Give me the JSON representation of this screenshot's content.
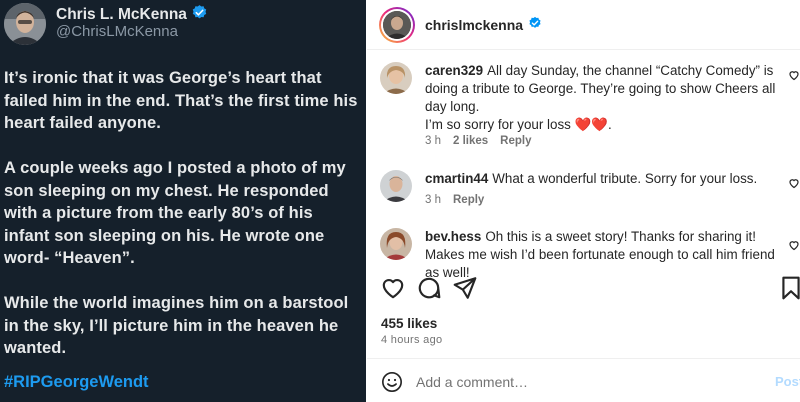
{
  "tweet": {
    "name": "Chris L. McKenna",
    "handle": "@ChrisLMcKenna",
    "paragraphs": [
      "It’s ironic that it was George’s heart that failed him in the end. That’s the first time his heart failed anyone.",
      "A couple weeks ago I posted a photo of my son sleeping on my chest. He responded with a picture from the early 80’s of his infant son sleeping on his. He wrote one word- “Heaven”.",
      "While the world imagines him on a barstool in the sky, I’ll picture him in the heaven he wanted."
    ],
    "hashtag": "#RIPGeorgeWendt"
  },
  "instagram": {
    "username": "chrislmckenna",
    "comments": [
      {
        "user": "caren329",
        "text": "All day Sunday, the channel “Catchy Comedy” is doing a tribute to George. They’re going to show Cheers all day long.",
        "text2": "I’m so sorry for your loss",
        "hearts": "❤️❤️",
        "end": ".",
        "time": "3 h",
        "likes": "2 likes",
        "reply": "Reply"
      },
      {
        "user": "cmartin44",
        "text": "What a wonderful tribute. Sorry for your loss.",
        "time": "3 h",
        "reply": "Reply"
      },
      {
        "user": "bev.hess",
        "text": "Oh this is a sweet story! Thanks for sharing it! Makes me wish I’d been fortunate enough to call him friend as well!"
      }
    ],
    "likes": "455 likes",
    "posted_ago": "4 hours ago",
    "add_comment_placeholder": "Add a comment…",
    "post_label": "Post"
  },
  "colors": {
    "twitter_bg": "#15202b",
    "twitter_link": "#1d9bf0",
    "verified_blue": "#1d9bf0",
    "instagram_verified": "#0095f6",
    "heart_red": "#e0245e",
    "post_button": "#b3dbff"
  }
}
